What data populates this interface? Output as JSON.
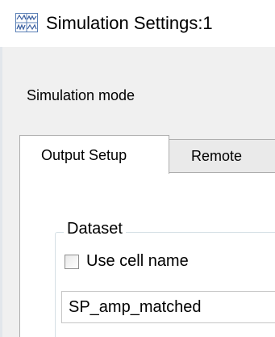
{
  "window": {
    "title": "Simulation Settings:1",
    "icon": "waveform-sim-icon"
  },
  "simulation_mode": {
    "label": "Simulation mode"
  },
  "tabs": [
    {
      "label": "Output Setup",
      "active": true
    },
    {
      "label": "Remote",
      "active": false
    }
  ],
  "dataset": {
    "title": "Dataset",
    "use_cell_name": {
      "label": "Use cell name",
      "checked": false
    },
    "name_value": "SP_amp_matched"
  }
}
